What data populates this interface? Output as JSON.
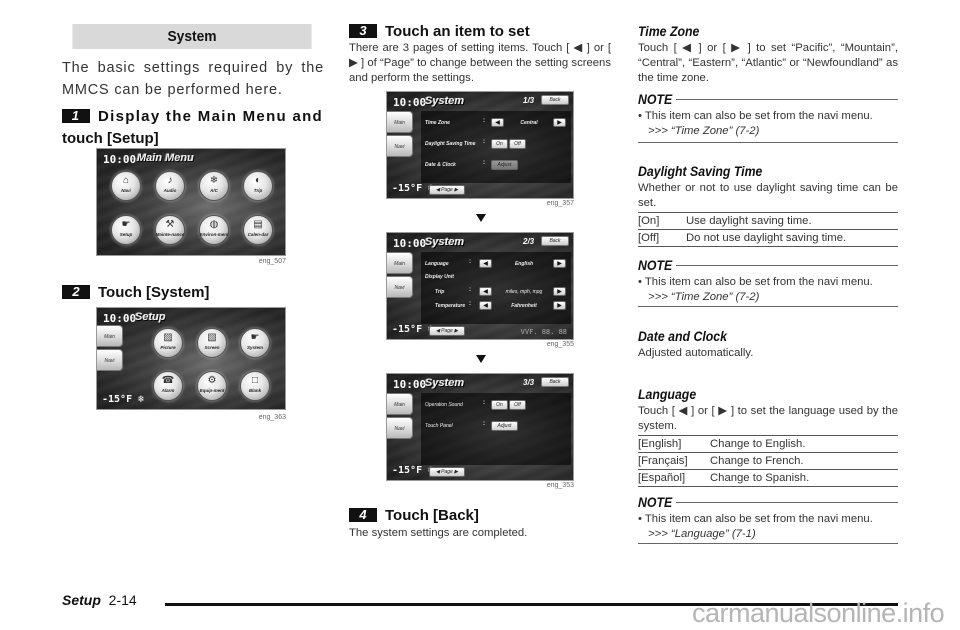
{
  "section": {
    "title": "System",
    "intro": "The basic settings required by the MMCS can be performed here."
  },
  "steps": [
    {
      "num": "1",
      "title_line1": "Display the Main Menu and",
      "title_line2": "touch [Setup]"
    },
    {
      "num": "2",
      "title": "Touch [System]"
    },
    {
      "num": "3",
      "title": "Touch an item to set",
      "text": "There are 3 pages of setting items. Touch [ ◀ ] or [ ▶ ] of “Page” to change between the setting screens and perform the settings."
    },
    {
      "num": "4",
      "title": "Touch [Back]",
      "text": "The system settings are completed."
    }
  ],
  "screens": {
    "main_menu": {
      "clock": "10:00",
      "title": "Main Menu",
      "caption": "eng_507",
      "buttons": [
        {
          "label": "Navi",
          "icon": "⌂"
        },
        {
          "label": "Audio",
          "icon": "♪"
        },
        {
          "label": "A/C",
          "icon": "❄"
        },
        {
          "label": "Trip",
          "icon": "◐"
        },
        {
          "label": "Setup",
          "icon": "☛"
        },
        {
          "label": "Mainte-nance",
          "icon": "⚒"
        },
        {
          "label": "Environ-ment",
          "icon": "◍"
        },
        {
          "label": "Calen-dar",
          "icon": "▤"
        }
      ]
    },
    "setup": {
      "clock": "10:00",
      "title": "Setup",
      "caption": "eng_363",
      "tabs": [
        "Main",
        "Navi"
      ],
      "temp": "-15°F ❄",
      "buttons": [
        {
          "label": "Picture",
          "icon": "▨"
        },
        {
          "label": "Screen",
          "icon": "▧"
        },
        {
          "label": "System",
          "icon": "☛"
        },
        {
          "label": "Alarm",
          "icon": "☎"
        },
        {
          "label": "Equip-ment",
          "icon": "⚙"
        },
        {
          "label": "Blank",
          "icon": "□"
        }
      ]
    },
    "system_pages": [
      {
        "clock": "10:00",
        "title": "System",
        "page": "1/3",
        "back": "Back",
        "caption": "eng_357",
        "tabs": [
          "Main",
          "Navi"
        ],
        "temp": "-15°F ❄",
        "page_btn": "◀ Page ▶",
        "rows": [
          {
            "label": "Time Zone",
            "type": "select",
            "value": "Central"
          },
          {
            "label": "Daylight Saving Time",
            "type": "onoff",
            "on": "On",
            "off": "Off"
          },
          {
            "label": "Date & Clock",
            "type": "button",
            "button": "Adjust"
          }
        ]
      },
      {
        "clock": "10:00",
        "title": "System",
        "page": "2/3",
        "back": "Back",
        "caption": "eng_355",
        "tabs": [
          "Main",
          "Navi"
        ],
        "temp": "-15°F ❄",
        "page_btn": "◀ Page ▶",
        "odo": "VVF. 88. 88",
        "rows": [
          {
            "label": "Language",
            "type": "select",
            "value": "English"
          },
          {
            "label": "Display Unit",
            "type": "heading"
          },
          {
            "label": "Trip",
            "type": "select",
            "value": "miles, mph, mpg"
          },
          {
            "label": "Temperature",
            "type": "select",
            "value": "Fahrenheit"
          }
        ]
      },
      {
        "clock": "10:00",
        "title": "System",
        "page": "3/3",
        "back": "Back",
        "caption": "eng_353",
        "tabs": [
          "Main",
          "Navi"
        ],
        "temp": "-15°F ❄",
        "page_btn": "◀ Page ▶",
        "rows": [
          {
            "label": "Operation Sound",
            "type": "onoff",
            "on": "On",
            "off": "Off"
          },
          {
            "label": "Touch Panel",
            "type": "button",
            "button": "Adjust"
          }
        ]
      }
    ]
  },
  "right": {
    "time_zone": {
      "title": "Time Zone",
      "text": "Touch [ ◀ ] or [ ▶ ] to set “Pacific”, “Mountain”, “Central”, “Eastern”, “Atlantic” or “Newfoundland” as the time zone.",
      "note_title": "NOTE",
      "note_text": "• This item can also be set from the navi menu.",
      "note_ref": ">>> “Time Zone” (7-2)"
    },
    "daylight": {
      "title": "Daylight Saving Time",
      "text": "Whether or not to use daylight saving time can be set.",
      "options": [
        {
          "key": "[On]",
          "desc": "Use daylight saving time."
        },
        {
          "key": "[Off]",
          "desc": "Do not use daylight saving time."
        }
      ],
      "note_title": "NOTE",
      "note_text": "• This item can also be set from the navi menu.",
      "note_ref": ">>> “Time Zone” (7-2)"
    },
    "date_clock": {
      "title": "Date and Clock",
      "text": "Adjusted automatically."
    },
    "language": {
      "title": "Language",
      "text": "Touch [ ◀ ] or [ ▶ ] to set the language used by the system.",
      "options": [
        {
          "key": "[English]",
          "desc": "Change to English."
        },
        {
          "key": "[Français]",
          "desc": "Change to French."
        },
        {
          "key": "[Español]",
          "desc": "Change to Spanish."
        }
      ],
      "note_title": "NOTE",
      "note_text": "• This item can also be set from the navi menu.",
      "note_ref": ">>> “Language” (7-1)"
    }
  },
  "footer": {
    "section": "Setup",
    "page": "2-14",
    "watermark": "carmanualsonline.info"
  }
}
